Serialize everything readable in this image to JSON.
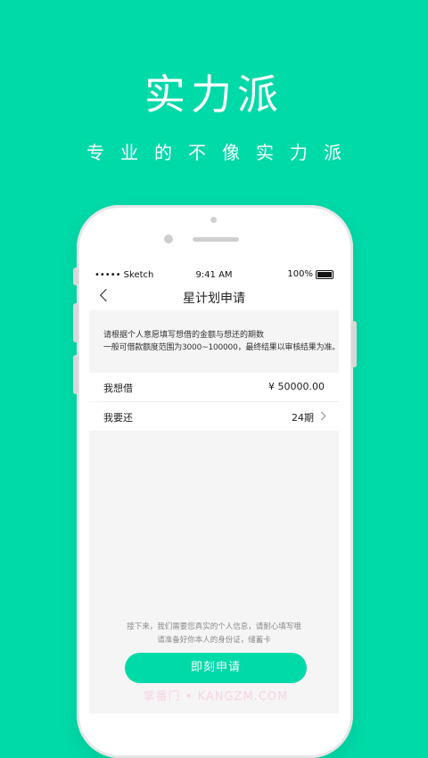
{
  "hero": {
    "title": "实力派",
    "subtitle": "专业的不像实力派"
  },
  "status_bar": {
    "carrier": "••••• Sketch",
    "time": "9:41 AM",
    "battery": "100%"
  },
  "nav": {
    "title": "星计划申请"
  },
  "notice": {
    "line1": "请根据个人意愿填写想借的金额与想还的期数",
    "line2": "一般可借款额度范围为3000~100000，最终结果以审核结果为准。"
  },
  "form": {
    "borrow_label": "我想借",
    "borrow_value": "¥ 50000.00",
    "repay_label": "我要还",
    "repay_value": "24期"
  },
  "hint": {
    "line1": "接下来，我们需要您真实的个人信息，请耐心填写哦",
    "line2": "请准备好你本人的身份证，储蓄卡"
  },
  "actions": {
    "apply_label": "即刻申请"
  },
  "watermark": "掌番门 • KANGZM.COM",
  "colors": {
    "brand": "#00d9a8",
    "screen_bg": "#f5f5f5"
  }
}
